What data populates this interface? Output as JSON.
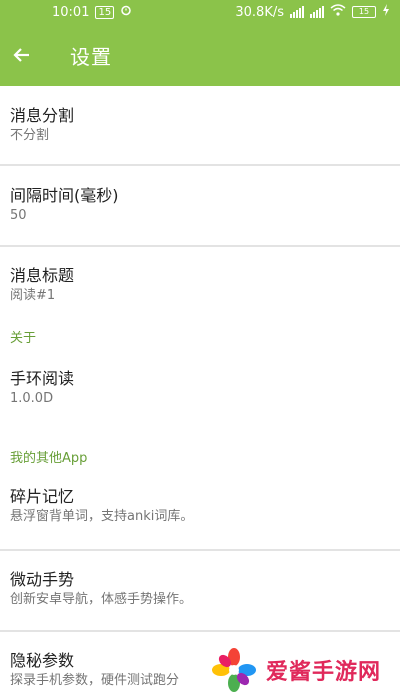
{
  "status_bar": {
    "time": "10:01",
    "notif_badge": "15",
    "speed": "30.8K/s",
    "battery": "15"
  },
  "app_bar": {
    "title": "设置"
  },
  "settings": {
    "split": {
      "title": "消息分割",
      "value": "不分割"
    },
    "interval": {
      "title": "间隔时间(毫秒)",
      "value": "50"
    },
    "msg_title": {
      "title": "消息标题",
      "value": "阅读#1"
    },
    "about_header": "关于",
    "reader": {
      "title": "手环阅读",
      "value": "1.0.0D"
    },
    "other_header": "我的其他App",
    "memory": {
      "title": "碎片记忆",
      "value": "悬浮窗背单词，支持anki词库。"
    },
    "gesture": {
      "title": "微动手势",
      "value": "创新安卓导航，体感手势操作。"
    },
    "secret": {
      "title": "隐秘参数",
      "value": "探录手机参数，硬件测试跑分"
    }
  },
  "watermark": {
    "text": "爱酱手游网"
  },
  "colors": {
    "primary": "#8BC34A",
    "accent": "#689F38"
  }
}
